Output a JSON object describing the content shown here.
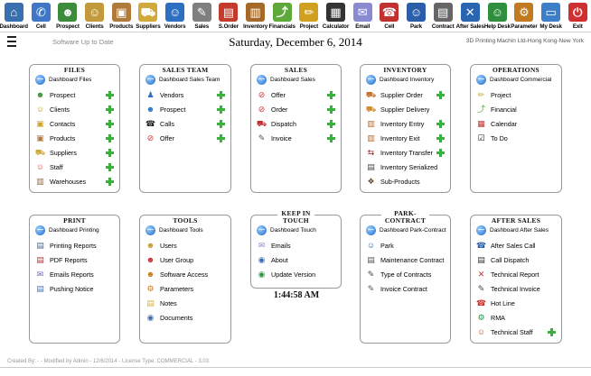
{
  "toolbar": {
    "buttons": [
      {
        "label": "Dashboard",
        "icon": "house-icon",
        "color": "#3a6fb0",
        "glyph": "⌂"
      },
      {
        "label": "Cell",
        "icon": "phone-icon",
        "color": "#3f77c6",
        "glyph": "✆"
      },
      {
        "label": "Prospect",
        "icon": "people-icon",
        "color": "#3c8c3c",
        "glyph": "☻"
      },
      {
        "label": "Clients",
        "icon": "clients-icon",
        "color": "#c29a3b",
        "glyph": "☺"
      },
      {
        "label": "Products",
        "icon": "box-icon",
        "color": "#b07a3a",
        "glyph": "▣"
      },
      {
        "label": "Suppliers",
        "icon": "truck-icon",
        "color": "#d1a83a",
        "glyph": "⛟"
      },
      {
        "label": "Vendors",
        "icon": "vendor-icon",
        "color": "#2f6fc2",
        "glyph": "☺"
      },
      {
        "label": "Sales",
        "icon": "sales-icon",
        "color": "#7f7f7f",
        "glyph": "✎"
      },
      {
        "label": "S.Order",
        "icon": "order-icon",
        "color": "#c33b2a",
        "glyph": "▤"
      },
      {
        "label": "Inventory",
        "icon": "barrel-icon",
        "color": "#a56a2a",
        "glyph": "▥"
      },
      {
        "label": "Financials",
        "icon": "chart-icon",
        "color": "#5fa83a",
        "glyph": "⤴"
      },
      {
        "label": "Project",
        "icon": "pencil-icon",
        "color": "#d0a020",
        "glyph": "✏"
      },
      {
        "label": "Calculator",
        "icon": "calculator-icon",
        "color": "#333333",
        "glyph": "▦"
      },
      {
        "label": "Email",
        "icon": "envelope-icon",
        "color": "#8a8ad0",
        "glyph": "✉"
      },
      {
        "label": "Cell",
        "icon": "cell-icon",
        "color": "#c23030",
        "glyph": "☎"
      },
      {
        "label": "Park",
        "icon": "worker-icon",
        "color": "#2a5ea8",
        "glyph": "☺"
      },
      {
        "label": "Contract",
        "icon": "contract-icon",
        "color": "#666666",
        "glyph": "▤"
      },
      {
        "label": "After Sales",
        "icon": "tools-icon",
        "color": "#2a66b0",
        "glyph": "✕"
      },
      {
        "label": "Help Desk",
        "icon": "helpdesk-icon",
        "color": "#2f8f3f",
        "glyph": "☺"
      },
      {
        "label": "Parameter",
        "icon": "gears-icon",
        "color": "#c27a20",
        "glyph": "⚙"
      },
      {
        "label": "My Desk",
        "icon": "monitor-icon",
        "color": "#3d7ec8",
        "glyph": "▭"
      },
      {
        "label": "Exit",
        "icon": "power-icon",
        "color": "#d03030",
        "glyph": "⏻"
      }
    ]
  },
  "status": {
    "text": "Software Up to Date",
    "date": "Saturday, December 6, 2014",
    "company": "3D Printing Machin Ltd-Hong Kong-New York"
  },
  "panels": {
    "files": {
      "title": "FILES",
      "header": "Dashboard Files",
      "items": [
        {
          "label": "Prospect",
          "icon": "people-icon",
          "glyph": "☻",
          "color": "#3c8c3c",
          "plus": true
        },
        {
          "label": "Clients",
          "icon": "clients-icon",
          "glyph": "☺",
          "color": "#c29a3b",
          "plus": true
        },
        {
          "label": "Contacts",
          "icon": "contacts-icon",
          "glyph": "▣",
          "color": "#d0a020",
          "plus": true
        },
        {
          "label": "Products",
          "icon": "box-icon",
          "glyph": "▣",
          "color": "#b07a3a",
          "plus": true
        },
        {
          "label": "Suppliers",
          "icon": "truck-icon",
          "glyph": "⛟",
          "color": "#d1a83a",
          "plus": true
        },
        {
          "label": "Staff",
          "icon": "staff-icon",
          "glyph": "☺",
          "color": "#c25a3a",
          "plus": true
        },
        {
          "label": "Warehouses",
          "icon": "warehouse-icon",
          "glyph": "▥",
          "color": "#8a6a3a",
          "plus": true
        }
      ]
    },
    "sales_team": {
      "title": "SALES TEAM",
      "header": "Dashboard Sales Team",
      "items": [
        {
          "label": "Vendors",
          "icon": "vendor-icon",
          "glyph": "♟",
          "color": "#2f6fc2",
          "plus": true
        },
        {
          "label": "Prospect",
          "icon": "prospect-icon",
          "glyph": "☻",
          "color": "#2f6fc2",
          "plus": true
        },
        {
          "label": "Calls",
          "icon": "phone-icon",
          "glyph": "☎",
          "color": "#222222",
          "plus": true
        },
        {
          "label": "Offer",
          "icon": "offer-icon",
          "glyph": "⊘",
          "color": "#d03030",
          "plus": true
        }
      ]
    },
    "sales": {
      "title": "SALES",
      "header": "Dashboard Sales",
      "items": [
        {
          "label": "Offer",
          "icon": "offer-icon",
          "glyph": "⊘",
          "color": "#d03030",
          "plus": true
        },
        {
          "label": "Order",
          "icon": "order-icon",
          "glyph": "⊘",
          "color": "#d03030",
          "plus": true
        },
        {
          "label": "Dispatch",
          "icon": "dispatch-icon",
          "glyph": "⛟",
          "color": "#c03030",
          "plus": true
        },
        {
          "label": "Invoice",
          "icon": "invoice-icon",
          "glyph": "✎",
          "color": "#555555",
          "plus": true
        }
      ]
    },
    "inventory": {
      "title": "INVENTORY",
      "header": "Dashboard Inventory",
      "items": [
        {
          "label": "Supplier Order",
          "icon": "supplier-order-icon",
          "glyph": "⛟",
          "color": "#c2702a",
          "plus": true
        },
        {
          "label": "Supplier Delivery",
          "icon": "delivery-icon",
          "glyph": "⛟",
          "color": "#d08a2a",
          "plus": false
        },
        {
          "label": "Inventory Entry",
          "icon": "entry-icon",
          "glyph": "▥",
          "color": "#b06a2a",
          "plus": true
        },
        {
          "label": "Inventory Exit",
          "icon": "exit-icon",
          "glyph": "▥",
          "color": "#b06a2a",
          "plus": true
        },
        {
          "label": "Inventory Transfer",
          "icon": "transfer-icon",
          "glyph": "⇆",
          "color": "#8a2a2a",
          "plus": true
        },
        {
          "label": "Inventory Serialized",
          "icon": "serialized-icon",
          "glyph": "▤",
          "color": "#444444",
          "plus": false
        },
        {
          "label": "Sub-Products",
          "icon": "subproducts-icon",
          "glyph": "❖",
          "color": "#6a4a2a",
          "plus": false
        }
      ]
    },
    "operations": {
      "title": "OPERATIONS",
      "header": "Dashboard Commercial",
      "items": [
        {
          "label": "Project",
          "icon": "pencil-icon",
          "glyph": "✏",
          "color": "#d0a020",
          "plus": false
        },
        {
          "label": "Financial",
          "icon": "chart-icon",
          "glyph": "⤴",
          "color": "#5fa83a",
          "plus": false
        },
        {
          "label": "Calendar",
          "icon": "calendar-icon",
          "glyph": "▦",
          "color": "#c03030",
          "plus": false
        },
        {
          "label": "To Do",
          "icon": "checkbox-icon",
          "glyph": "☑",
          "color": "#222222",
          "plus": false
        }
      ]
    },
    "print": {
      "title": "PRINT",
      "header": "Dashboard Printing",
      "items": [
        {
          "label": "Printing Reports",
          "icon": "printer-icon",
          "glyph": "▤",
          "color": "#4a6a9a",
          "plus": false
        },
        {
          "label": "PDF Reports",
          "icon": "pdf-icon",
          "glyph": "▤",
          "color": "#c03030",
          "plus": false
        },
        {
          "label": "Emails Reports",
          "icon": "email-report-icon",
          "glyph": "✉",
          "color": "#6a6ac0",
          "plus": false
        },
        {
          "label": "Pushing Notice",
          "icon": "notice-icon",
          "glyph": "▤",
          "color": "#3a7ac0",
          "plus": false
        }
      ]
    },
    "tools": {
      "title": "TOOLS",
      "header": "Dashboard Tools",
      "items": [
        {
          "label": "Users",
          "icon": "users-icon",
          "glyph": "☻",
          "color": "#c29a3b",
          "plus": false
        },
        {
          "label": "User Group",
          "icon": "user-group-icon",
          "glyph": "☻",
          "color": "#c23030",
          "plus": false
        },
        {
          "label": "Software Access",
          "icon": "access-icon",
          "glyph": "☻",
          "color": "#c27a20",
          "plus": false
        },
        {
          "label": "Parameters",
          "icon": "gears-icon",
          "glyph": "⚙",
          "color": "#c27a20",
          "plus": false
        },
        {
          "label": "Notes",
          "icon": "notes-icon",
          "glyph": "▤",
          "color": "#e0b030",
          "plus": false
        },
        {
          "label": "Documents",
          "icon": "documents-icon",
          "glyph": "◉",
          "color": "#3a6ab0",
          "plus": false
        }
      ]
    },
    "keep_in_touch": {
      "title_line1": "KEEP IN",
      "title_line2": "TOUCH",
      "header": "Dashboard Touch",
      "items": [
        {
          "label": "Emails",
          "icon": "envelope-icon",
          "glyph": "✉",
          "color": "#8a8ad0",
          "plus": false
        },
        {
          "label": "About",
          "icon": "about-icon",
          "glyph": "◉",
          "color": "#3a6ab0",
          "plus": false
        },
        {
          "label": "Update Version",
          "icon": "update-icon",
          "glyph": "◉",
          "color": "#2f8f3f",
          "plus": false
        }
      ]
    },
    "park_contract": {
      "title_line1": "PARK-",
      "title_line2": "CONTRACT",
      "header": "Dashboard Park-Contract",
      "items": [
        {
          "label": "Park",
          "icon": "park-icon",
          "glyph": "☺",
          "color": "#2a5ea8",
          "plus": false
        },
        {
          "label": "Maintenance Contract",
          "icon": "maintenance-icon",
          "glyph": "▤",
          "color": "#555555",
          "plus": false
        },
        {
          "label": "Type of Contracts",
          "icon": "contract-type-icon",
          "glyph": "✎",
          "color": "#444444",
          "plus": false
        },
        {
          "label": "Invoice Contract",
          "icon": "invoice-contract-icon",
          "glyph": "✎",
          "color": "#555555",
          "plus": false
        }
      ]
    },
    "after_sales": {
      "title": "AFTER SALES",
      "header": "Dashboard After Sales",
      "items": [
        {
          "label": "After Sales Call",
          "icon": "call-icon",
          "glyph": "☎",
          "color": "#2a5ea8",
          "plus": false
        },
        {
          "label": "Call Dispatch",
          "icon": "dispatch-call-icon",
          "glyph": "▤",
          "color": "#333333",
          "plus": false
        },
        {
          "label": "Technical Report",
          "icon": "tech-report-icon",
          "glyph": "✕",
          "color": "#c03030",
          "plus": false
        },
        {
          "label": "Technical Invoice",
          "icon": "tech-invoice-icon",
          "glyph": "✎",
          "color": "#444444",
          "plus": false
        },
        {
          "label": "Hot Line",
          "icon": "hotline-icon",
          "glyph": "☎",
          "color": "#d03030",
          "plus": false
        },
        {
          "label": "RMA",
          "icon": "rma-icon",
          "glyph": "⚙",
          "color": "#2f8f3f",
          "plus": false
        },
        {
          "label": "Technical Staff",
          "icon": "tech-staff-icon",
          "glyph": "☺",
          "color": "#c25a3a",
          "plus": true
        }
      ]
    }
  },
  "clock": "1:44:58 AM",
  "footer": "Created By:  -  - Modified by Admin - 12/6/2014 - License Type: COMMERCIAL - 3.03"
}
